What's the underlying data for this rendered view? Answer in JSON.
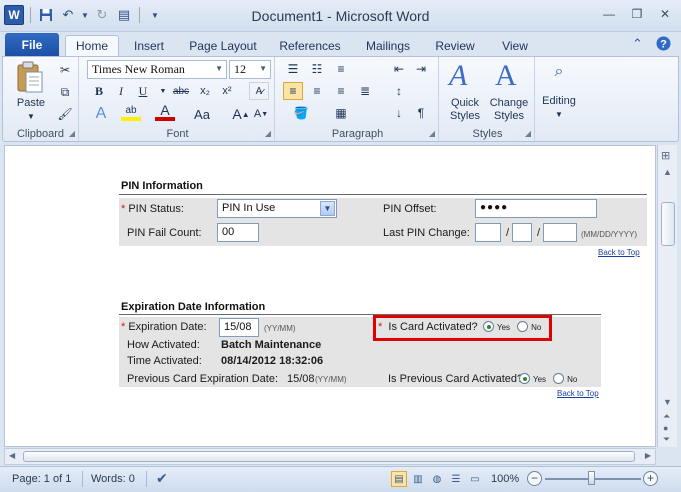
{
  "app": {
    "title": "Document1  -  Microsoft Word",
    "logo_letter": "W"
  },
  "ribbon_tabs": {
    "file": "File",
    "tabs": [
      "Home",
      "Insert",
      "Page Layout",
      "References",
      "Mailings",
      "Review",
      "View"
    ],
    "active": "Home"
  },
  "ribbon": {
    "clipboard": {
      "label": "Clipboard",
      "paste": "Paste"
    },
    "font": {
      "label": "Font",
      "family": "Times New Roman",
      "size": "12"
    },
    "paragraph": {
      "label": "Paragraph"
    },
    "styles": {
      "label": "Styles",
      "quick_styles": "Quick Styles",
      "change_styles": "Change Styles"
    },
    "editing": {
      "label": "Editing"
    }
  },
  "form": {
    "pin": {
      "title": "PIN Information",
      "status_label": "PIN Status:",
      "status_value": "PIN In Use",
      "offset_label": "PIN Offset:",
      "offset_value": "●●●●",
      "fail_label": "PIN Fail Count:",
      "fail_value": "00",
      "last_change_label": "Last PIN Change:",
      "date_format": "(MM/DD/YYYY)",
      "back_to_top": "Back to Top"
    },
    "expiration": {
      "title": "Expiration Date Information",
      "date_label": "Expiration Date:",
      "date_value": "15/08",
      "date_format": "(YY/MM)",
      "activated_label": "Is Card Activated?",
      "yes": "Yes",
      "no": "No",
      "how_label": "How Activated:",
      "how_value": "Batch Maintenance",
      "time_label": "Time Activated:",
      "time_value": "08/14/2012 18:32:06",
      "prev_label": "Previous Card Expiration Date:",
      "prev_value": "15/08",
      "prev_format": "(YY/MM)",
      "prev_activated_label": "Is Previous Card Activated?",
      "back_to_top": "Back to Top"
    }
  },
  "statusbar": {
    "page": "Page: 1 of 1",
    "words": "Words: 0",
    "zoom": "100%"
  }
}
